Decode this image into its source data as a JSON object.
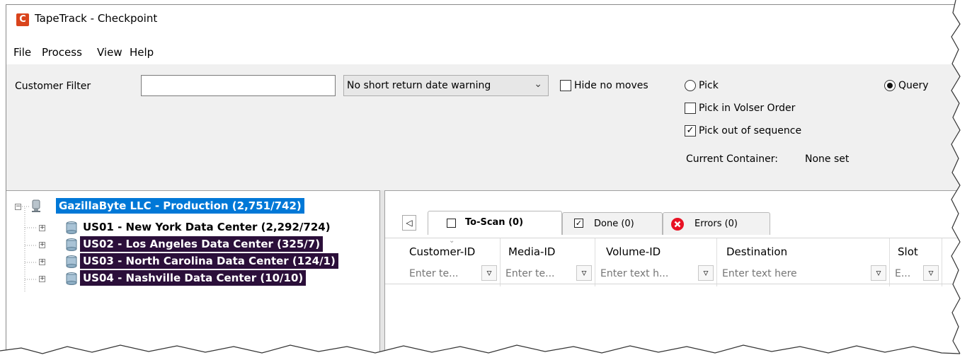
{
  "window": {
    "title": "TapeTrack - Checkpoint",
    "app_icon_letter": "C"
  },
  "menu": [
    "File",
    "Process",
    "View",
    "Help"
  ],
  "toolbar": {
    "customer_filter_label": "Customer Filter",
    "customer_filter_value": "",
    "warning_select": "No short return date warning",
    "hide_no_moves": {
      "label": "Hide no moves",
      "checked": false
    },
    "pick": {
      "label": "Pick",
      "selected": false
    },
    "query": {
      "label": "Query",
      "selected": true
    },
    "pick_in_volser_order": {
      "label": "Pick in Volser Order",
      "checked": false
    },
    "pick_out_of_sequence": {
      "label": "Pick out of sequence",
      "checked": true
    },
    "current_container_label": "Current Container:",
    "current_container_value": "None set"
  },
  "tree": {
    "root": {
      "label": "GazillaByte LLC - Production (2,751/742)"
    },
    "children": [
      {
        "label": "US01 - New York Data Center (2,292/724)",
        "highlight": "none"
      },
      {
        "label": "US02 - Los Angeles Data Center (325/7)",
        "highlight": "dark"
      },
      {
        "label": "US03 - North Carolina Data Center (124/1)",
        "highlight": "dark"
      },
      {
        "label": "US04 - Nashville Data Center (10/10)",
        "highlight": "dark"
      }
    ]
  },
  "tabs": [
    {
      "label": "To-Scan (0)",
      "icon": "unchecked-box-icon"
    },
    {
      "label": "Done (0)",
      "icon": "checked-box-icon"
    },
    {
      "label": "Errors (0)",
      "icon": "error-icon"
    }
  ],
  "grid": {
    "columns": [
      "Customer-ID",
      "Media-ID",
      "Volume-ID",
      "Destination",
      "Slot"
    ],
    "filter_placeholders": [
      "Enter te...",
      "Enter te...",
      "Enter text h...",
      "Enter text here",
      "E..."
    ]
  },
  "colors": {
    "selection_blue": "#0078d7",
    "highlight_dark": "#2b0f3a",
    "error_red": "#e81123",
    "app_icon": "#d9441c"
  }
}
